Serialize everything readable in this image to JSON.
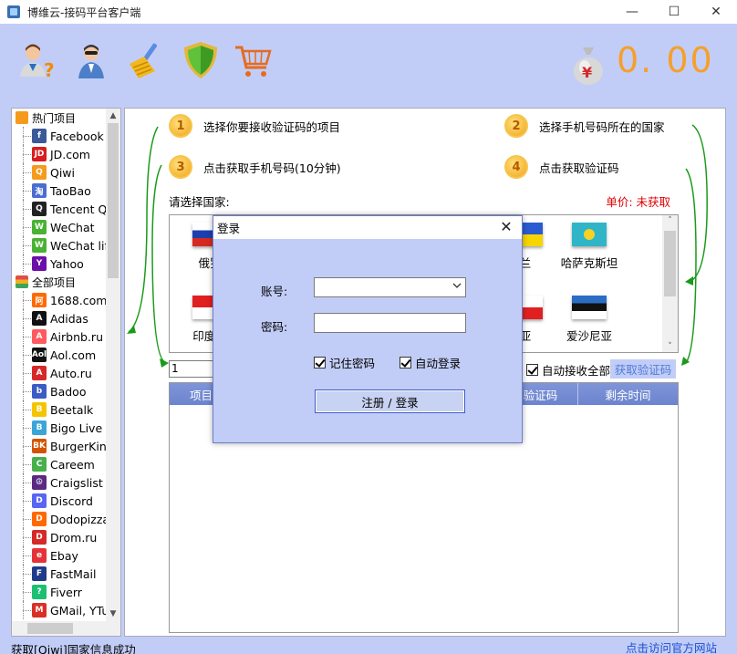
{
  "window": {
    "title": "博维云-接码平台客户端",
    "minimize_symbol": "—",
    "maximize_symbol": "☐",
    "close_symbol": "✕"
  },
  "toolbar": {
    "tools": [
      "help-user-icon",
      "agent-user-icon",
      "clean-broom-icon",
      "shield-icon",
      "cart-icon"
    ],
    "currency_symbol": "¥",
    "balance": "0. 00"
  },
  "tree": {
    "groups": [
      {
        "label": "热门项目",
        "items": [
          {
            "label": "Facebook",
            "icon": "facebook-icon",
            "color": "#3b5998",
            "glyph": "f"
          },
          {
            "label": "JD.com",
            "icon": "jd-icon",
            "color": "#d71d1d",
            "glyph": "JD"
          },
          {
            "label": "Qiwi",
            "icon": "qiwi-icon",
            "color": "#f59a1b",
            "glyph": "Q"
          },
          {
            "label": "TaoBao",
            "icon": "taobao-icon",
            "color": "#4b6cd0",
            "glyph": "淘"
          },
          {
            "label": "Tencent Q",
            "icon": "tencent-qq-icon",
            "color": "#222222",
            "glyph": "Q"
          },
          {
            "label": "WeChat",
            "icon": "wechat-icon",
            "color": "#49b233",
            "glyph": "W"
          },
          {
            "label": "WeChat lif",
            "icon": "wechat-life-icon",
            "color": "#49b233",
            "glyph": "W"
          },
          {
            "label": "Yahoo",
            "icon": "yahoo-icon",
            "color": "#6b0fa8",
            "glyph": "Y"
          }
        ]
      },
      {
        "label": "全部项目",
        "items": [
          {
            "label": "1688.com",
            "icon": "1688-icon",
            "color": "#ff6a00",
            "glyph": "阿"
          },
          {
            "label": "Adidas",
            "icon": "adidas-icon",
            "color": "#111111",
            "glyph": "A"
          },
          {
            "label": "Airbnb.ru",
            "icon": "airbnb-icon",
            "color": "#ff5a5f",
            "glyph": "A"
          },
          {
            "label": "Aol.com",
            "icon": "aol-icon",
            "color": "#111111",
            "glyph": "Aol"
          },
          {
            "label": "Auto.ru",
            "icon": "auto-ru-icon",
            "color": "#d62828",
            "glyph": "A"
          },
          {
            "label": "Badoo",
            "icon": "badoo-icon",
            "color": "#3b5cc4",
            "glyph": "b"
          },
          {
            "label": "Beetalk",
            "icon": "beetalk-icon",
            "color": "#f5c400",
            "glyph": "B"
          },
          {
            "label": "Bigo Live",
            "icon": "bigo-live-icon",
            "color": "#3aa5d8",
            "glyph": "B"
          },
          {
            "label": "BurgerKing",
            "icon": "burger-king-icon",
            "color": "#d35400",
            "glyph": "BK"
          },
          {
            "label": "Careem",
            "icon": "careem-icon",
            "color": "#47b04b",
            "glyph": "C"
          },
          {
            "label": "Craigslist",
            "icon": "craigslist-icon",
            "color": "#5a2a82",
            "glyph": "☮"
          },
          {
            "label": "Discord",
            "icon": "discord-icon",
            "color": "#5865f2",
            "glyph": "D"
          },
          {
            "label": "Dodopizza",
            "icon": "dodopizza-icon",
            "color": "#ff6900",
            "glyph": "D"
          },
          {
            "label": "Drom.ru",
            "icon": "drom-ru-icon",
            "color": "#d62828",
            "glyph": "D"
          },
          {
            "label": "Ebay",
            "icon": "ebay-icon",
            "color": "#e53238",
            "glyph": "e"
          },
          {
            "label": "FastMail",
            "icon": "fastmail-icon",
            "color": "#1f3a8a",
            "glyph": "F"
          },
          {
            "label": "Fiverr",
            "icon": "fiverr-icon",
            "color": "#1dbf73",
            "glyph": "?"
          },
          {
            "label": "GMail, YTu",
            "icon": "gmail-icon",
            "color": "#d93025",
            "glyph": "M"
          }
        ]
      }
    ]
  },
  "steps": [
    {
      "num": "1",
      "text": "选择你要接收验证码的项目"
    },
    {
      "num": "2",
      "text": "选择手机号码所在的国家"
    },
    {
      "num": "3",
      "text": "点击获取手机号码(10分钟)"
    },
    {
      "num": "4",
      "text": "点击获取验证码"
    }
  ],
  "country_section": {
    "label": "请选择国家:",
    "unit_price": "单价: 未获取",
    "countries": [
      {
        "name": "俄罗",
        "flag": "russia-flag"
      },
      {
        "name": "兰",
        "flag": "ukraine-flag"
      },
      {
        "name": "哈萨克斯坦",
        "flag": "kazakhstan-flag"
      },
      {
        "name": "印度尼",
        "flag": "indonesia-flag"
      },
      {
        "name": "亚",
        "flag": "partial-flag"
      },
      {
        "name": "爱沙尼亚",
        "flag": "estonia-flag"
      }
    ]
  },
  "controls": {
    "quantity_value": "1",
    "auto_receive_label": "自动接收全部",
    "auto_receive_checked": true,
    "get_code_label": "获取验证码"
  },
  "table": {
    "columns": [
      "项目",
      "",
      "验证码",
      "剩余时间"
    ]
  },
  "status": {
    "message": "获取[Qiwi]国家信息成功",
    "official_site_link": "点击访问官方网站"
  },
  "login_dialog": {
    "title": "登录",
    "account_label": "账号:",
    "account_value": "",
    "password_label": "密码:",
    "password_value": "",
    "remember_password_label": "记住密码",
    "remember_password_checked": true,
    "auto_login_label": "自动登录",
    "auto_login_checked": true,
    "submit_label": "注册 / 登录"
  },
  "colors": {
    "background": "#c2cdf7",
    "balance": "#f5a02a",
    "price_red": "#e00000",
    "arrow_green": "#1a9a1a",
    "table_header": "#7088d2",
    "link_blue": "#1a4fd0"
  }
}
